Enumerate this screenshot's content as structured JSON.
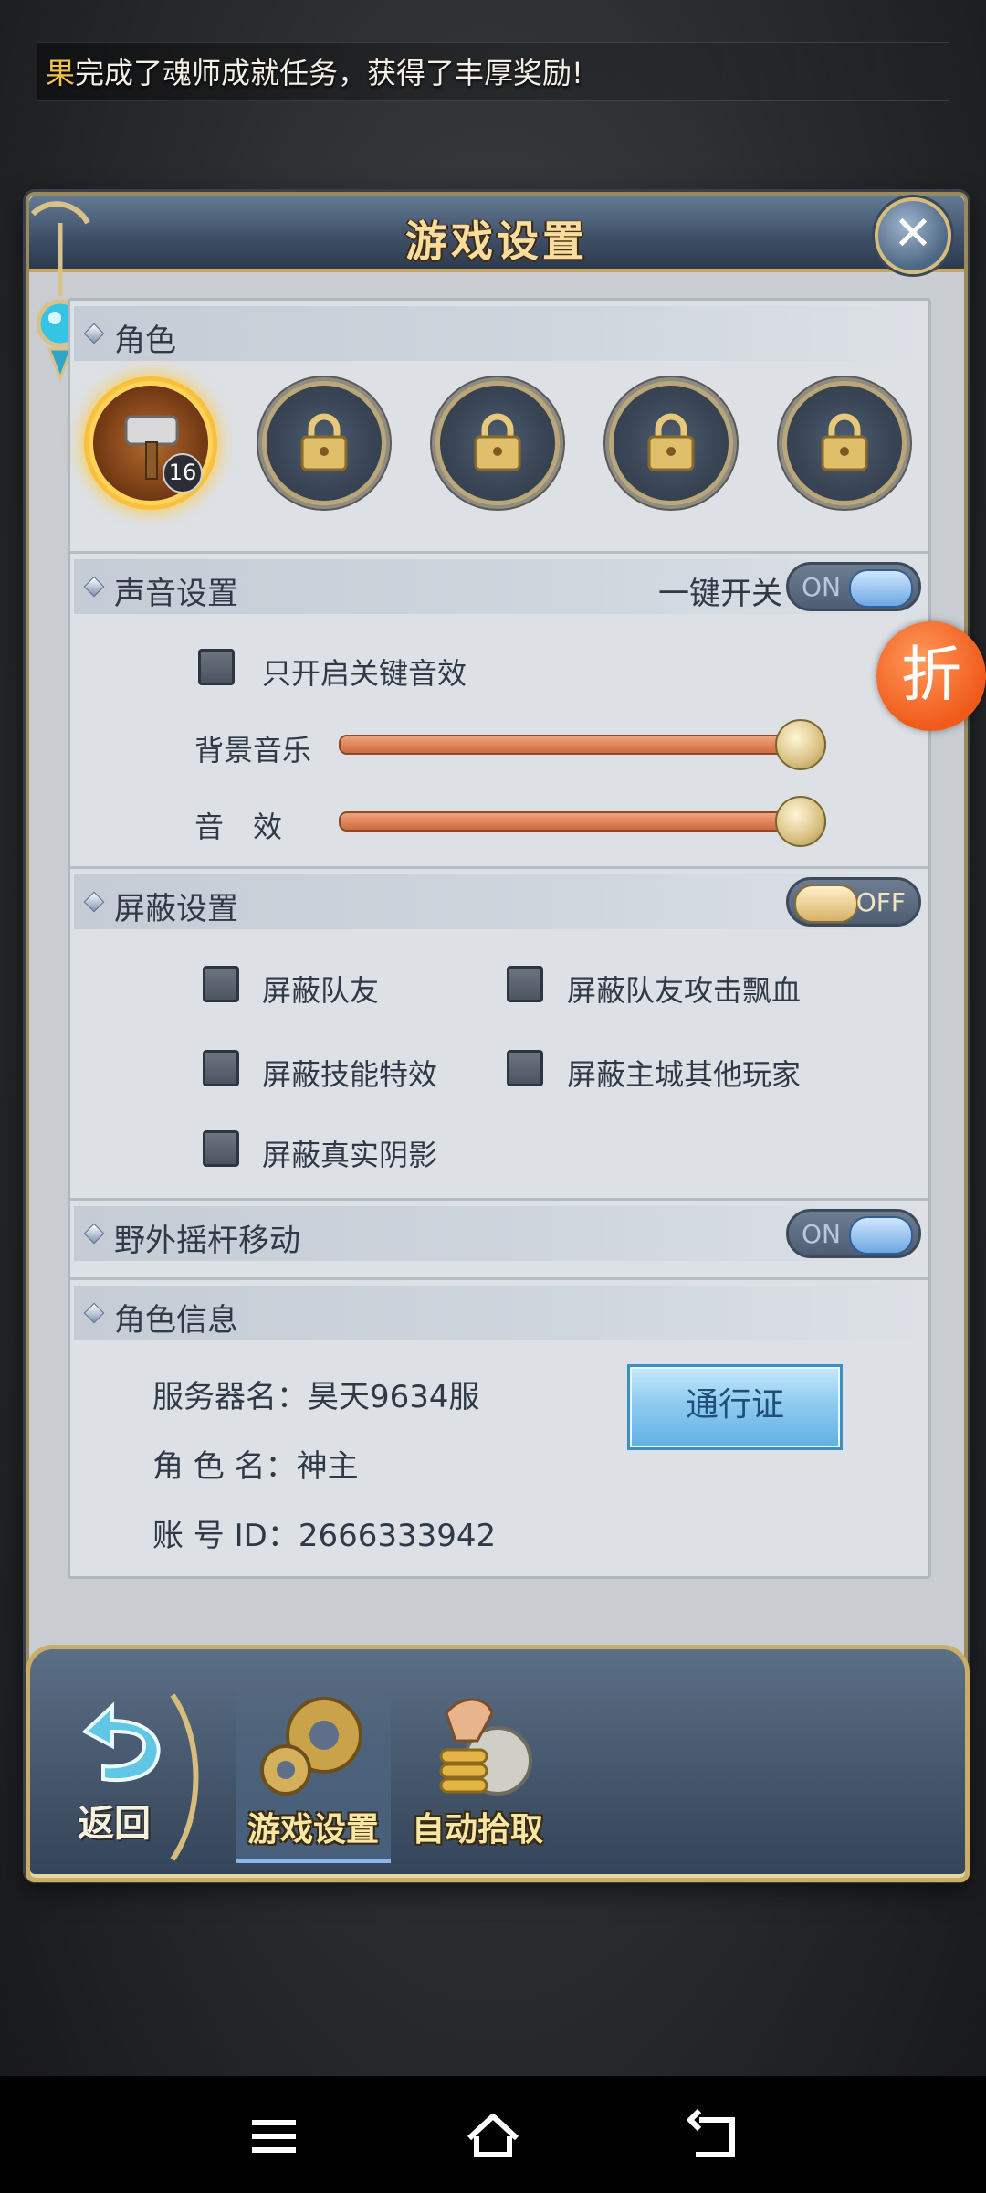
{
  "marquee": {
    "lead": "果",
    "text": "完成了魂师成就任务，获得了丰厚奖励!"
  },
  "dialog": {
    "title": "游戏设置",
    "close_icon": "close-icon"
  },
  "role": {
    "title": "角色",
    "slots": [
      {
        "state": "active",
        "icon": "hammer-weapon-icon",
        "level": "16"
      },
      {
        "state": "locked",
        "icon": "lock-icon"
      },
      {
        "state": "locked",
        "icon": "lock-icon"
      },
      {
        "state": "locked",
        "icon": "lock-icon"
      },
      {
        "state": "locked",
        "icon": "lock-icon"
      }
    ]
  },
  "sound": {
    "title": "声音设置",
    "master_label": "一键开关",
    "master_toggle": "ON",
    "key_sfx_label": "只开启关键音效",
    "bgm_label": "背景音乐",
    "bgm_level": 0.95,
    "sfx_label": "音　效",
    "sfx_level": 0.95
  },
  "block": {
    "title": "屏蔽设置",
    "toggle": "OFF",
    "options": [
      "屏蔽队友",
      "屏蔽队友攻击飘血",
      "屏蔽技能特效",
      "屏蔽主城其他玩家",
      "屏蔽真实阴影"
    ]
  },
  "joystick": {
    "title": "野外摇杆移动",
    "toggle": "ON"
  },
  "info": {
    "title": "角色信息",
    "server": "服务器名：昊天9634服",
    "role_name": "角 色 名：神主",
    "account": "账 号 ID：2666333942",
    "pass_button": "通行证"
  },
  "bottom": {
    "back_label": "返回",
    "tabs": [
      "游戏设置",
      "自动拾取"
    ]
  },
  "floating": {
    "discount": "折"
  },
  "colors": {
    "accent_gold": "#c9ad69",
    "panel": "#dde1e6",
    "slider": "#cf6a3f",
    "toggle_on": "#6ea7e2"
  }
}
